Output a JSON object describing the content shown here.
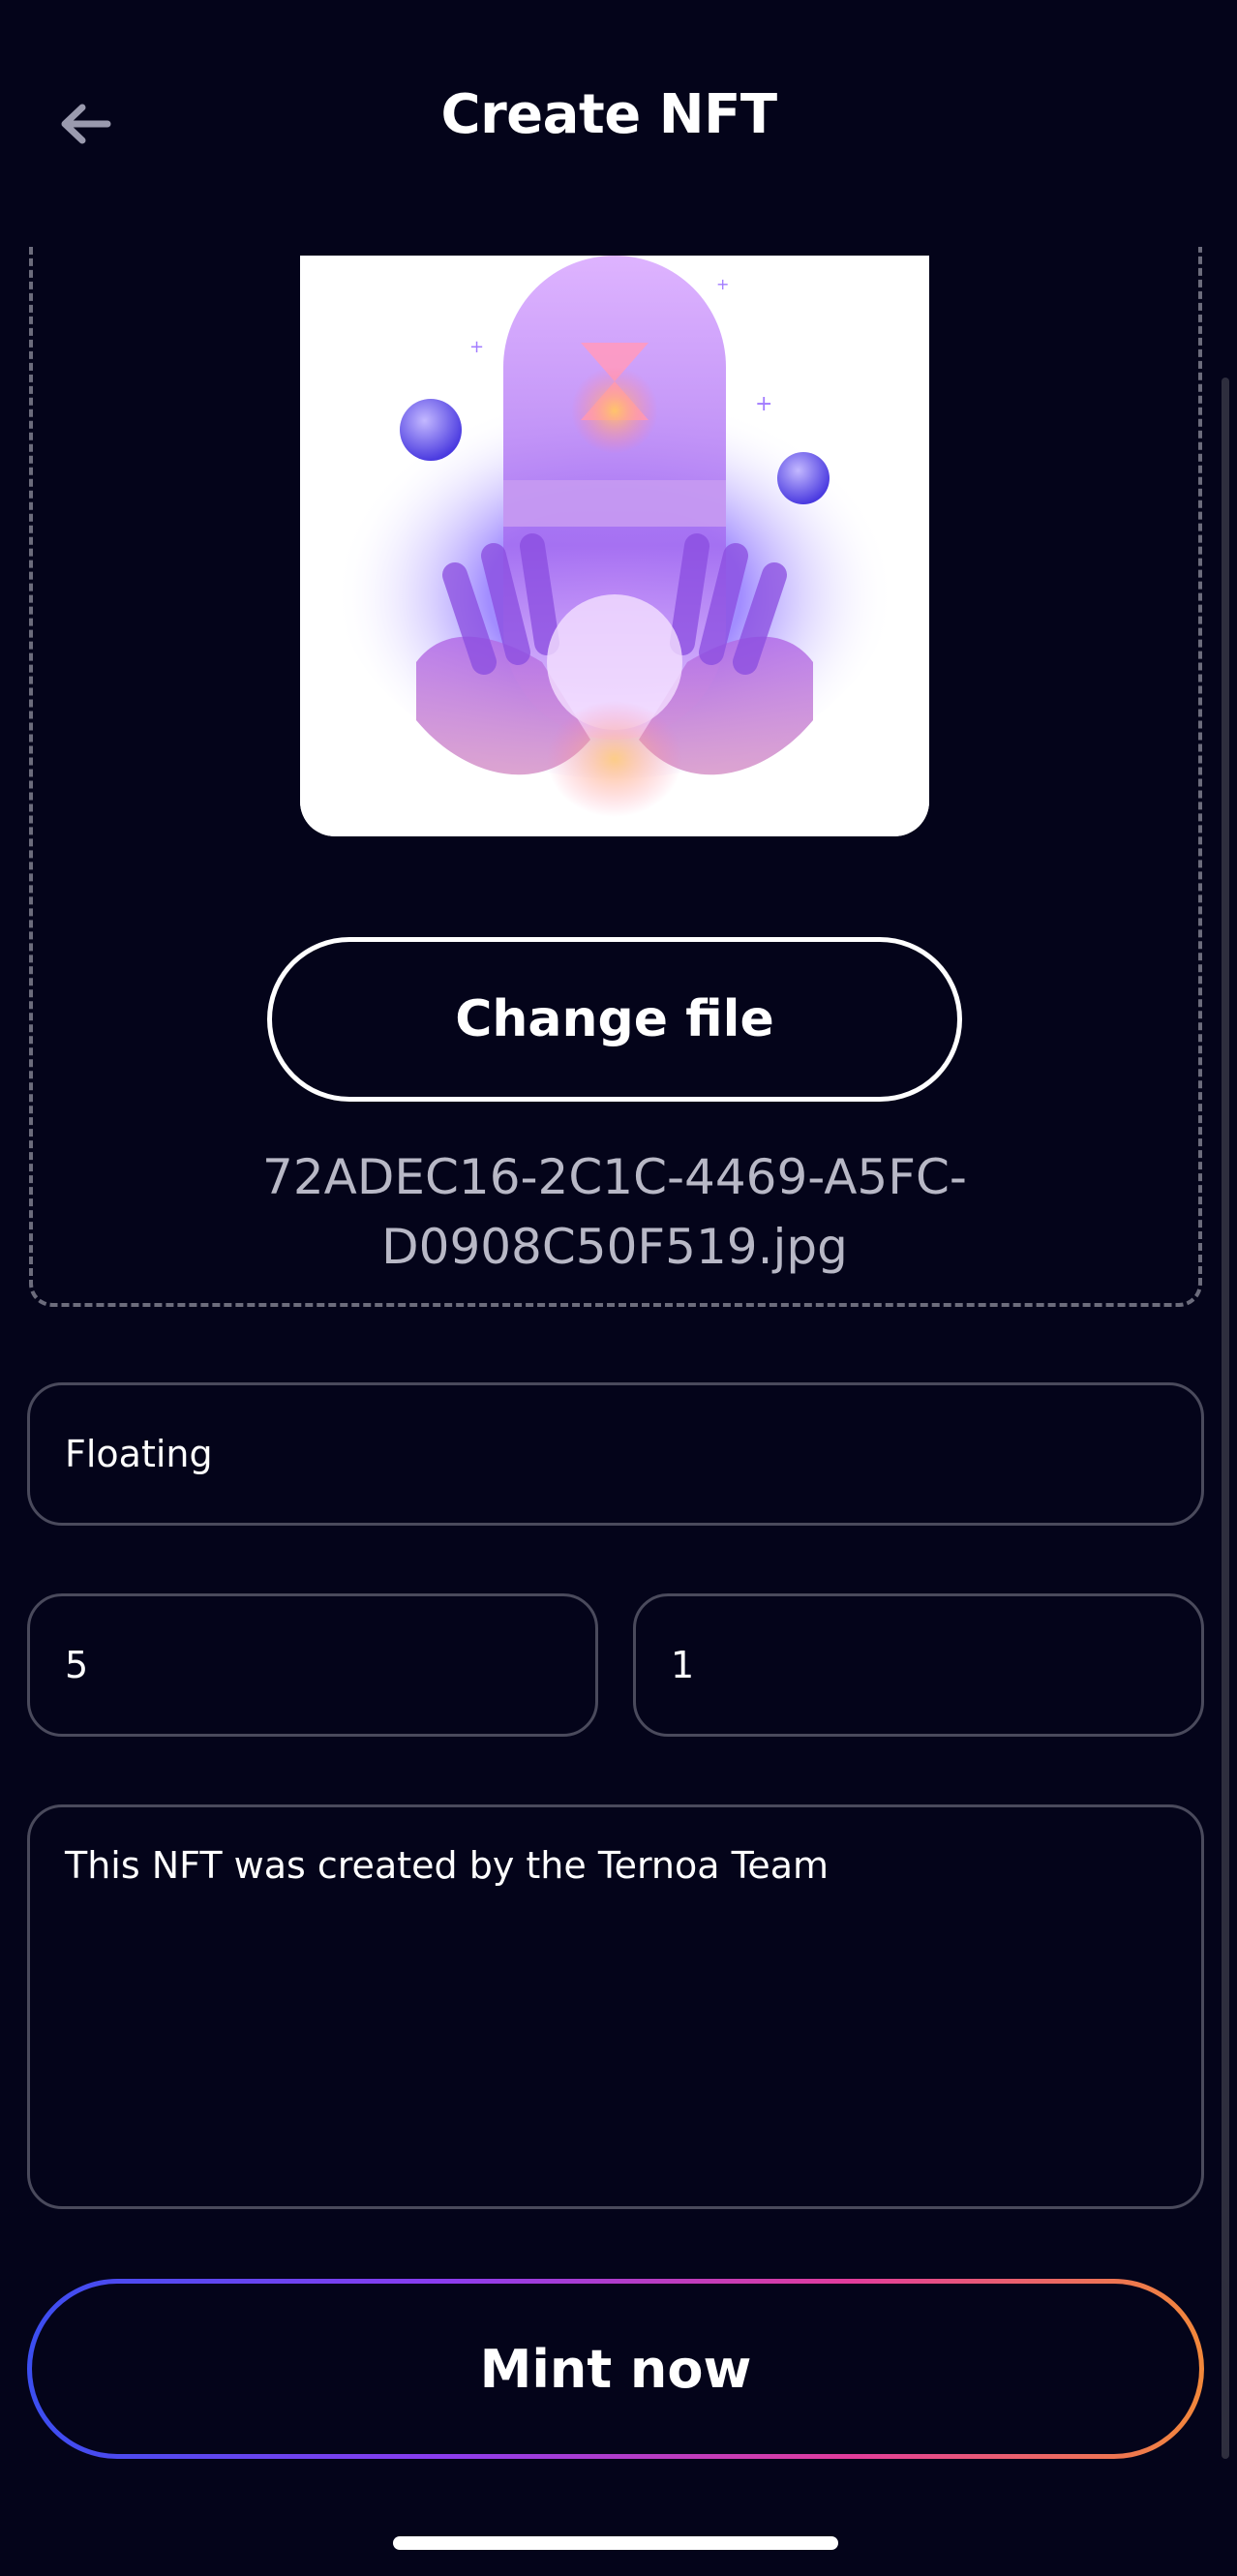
{
  "header": {
    "title": "Create NFT",
    "back_icon": "arrow-left-icon"
  },
  "upload": {
    "change_label": "Change file",
    "filename": "72ADEC16-2C1C-4469-A5FC-D0908C50F519.jpg"
  },
  "form": {
    "name_value": "Floating",
    "quantity_value": "5",
    "royalty_value": "1",
    "description_value": "This NFT was created by the Ternoa Team"
  },
  "actions": {
    "mint_label": "Mint now"
  },
  "colors": {
    "background": "#04041a",
    "gradient_start": "#3b4ef0",
    "gradient_end": "#f2883a",
    "field_border": "#4a4a5c"
  }
}
